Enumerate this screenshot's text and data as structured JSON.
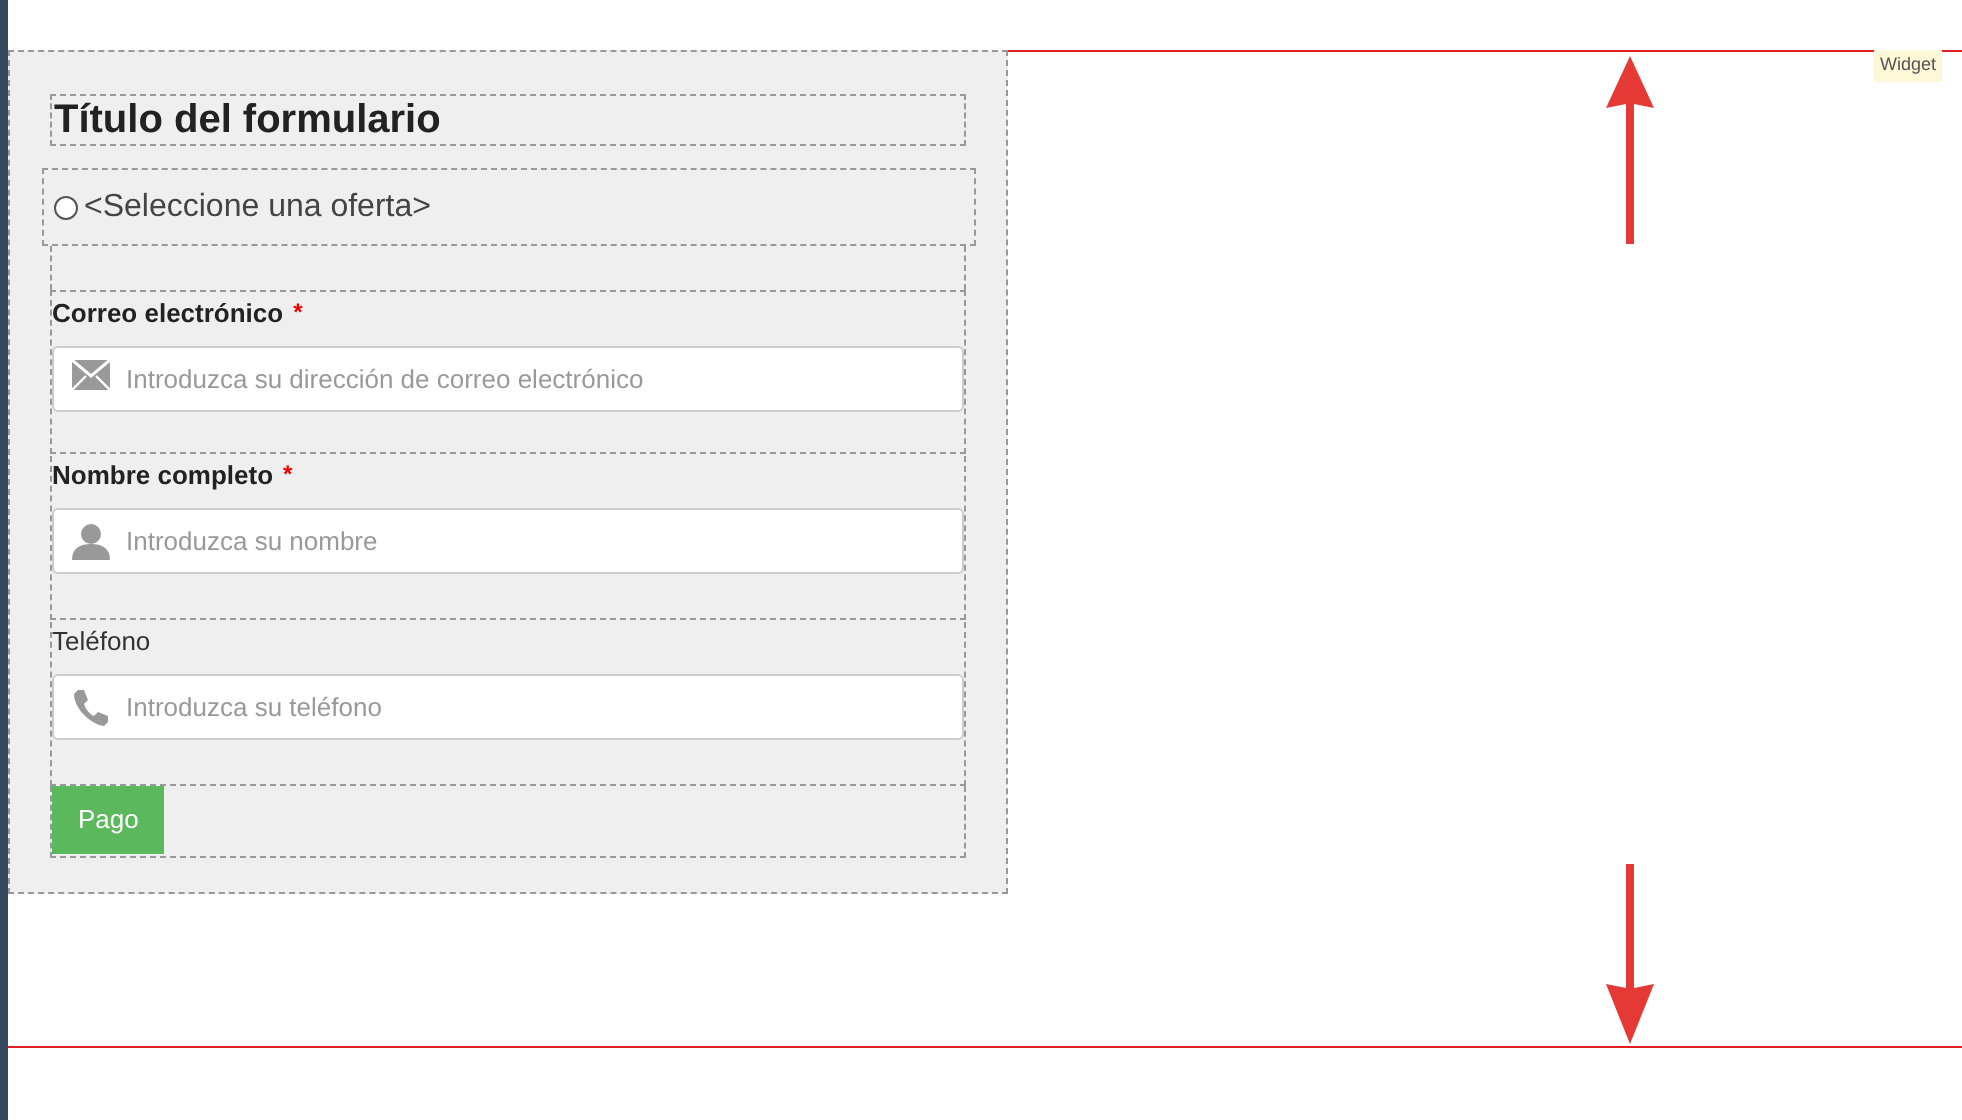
{
  "widget_label": "Widget",
  "form": {
    "title": "Título del formulario",
    "offer": {
      "label": "<Seleccione una oferta>",
      "selected": false
    },
    "fields": [
      {
        "label": "Correo electrónico",
        "required": true,
        "required_mark": "*",
        "placeholder": "Introduzca su dirección de correo electrónico",
        "kind": "email"
      },
      {
        "label": "Nombre completo",
        "required": true,
        "required_mark": "*",
        "placeholder": "Introduzca su nombre",
        "kind": "name"
      },
      {
        "label": "Teléfono",
        "required": false,
        "placeholder": "Introduzca su teléfono",
        "kind": "phone"
      }
    ],
    "submit": "Pago"
  }
}
